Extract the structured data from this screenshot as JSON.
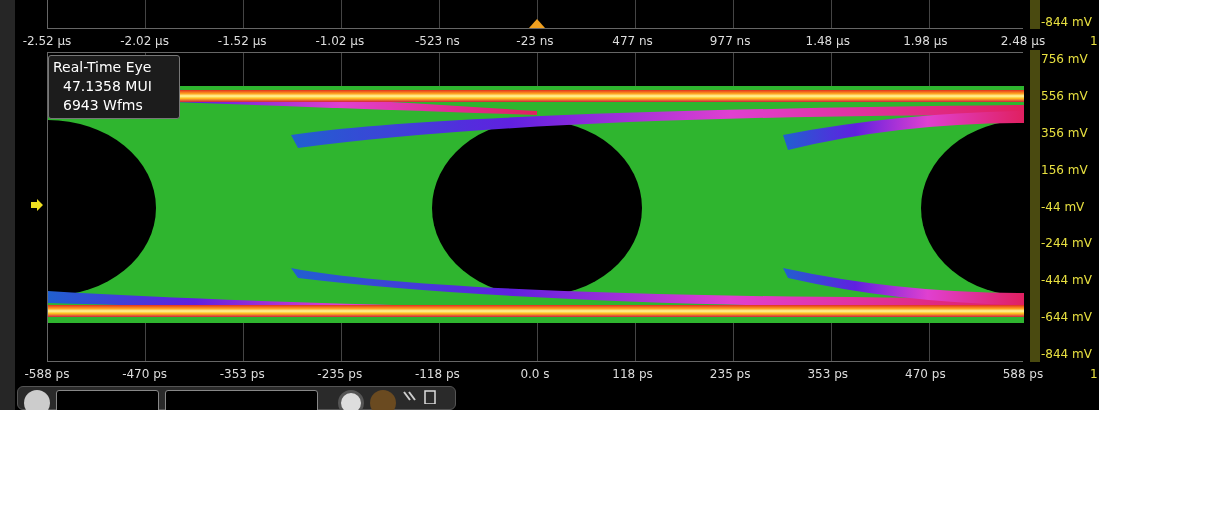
{
  "top_plot": {
    "y_label": "-844 mV",
    "trigger_marker": true
  },
  "time_axis": [
    "-2.52 µs",
    "-2.02 µs",
    "-1.52 µs",
    "-1.02 µs",
    "-523 ns",
    "-23 ns",
    "477 ns",
    "977 ns",
    "1.48 µs",
    "1.98 µs",
    "2.48 µs"
  ],
  "time_axis_channel": "1",
  "eye_plot": {
    "readout": {
      "title": "Real-Time Eye",
      "lines": [
        "47.1358 MUI",
        "6943 Wfms"
      ]
    },
    "y_labels": [
      "756 mV",
      "556 mV",
      "356 mV",
      "156 mV",
      "-44 mV",
      "-244 mV",
      "-444 mV",
      "-644 mV",
      "-844 mV"
    ]
  },
  "ui_axis": [
    "-588 ps",
    "-470 ps",
    "-353 ps",
    "-235 ps",
    "-118 ps",
    "0.0 s",
    "118 ps",
    "235 ps",
    "353 ps",
    "470 ps",
    "588 ps"
  ],
  "ui_axis_channel": "1"
}
